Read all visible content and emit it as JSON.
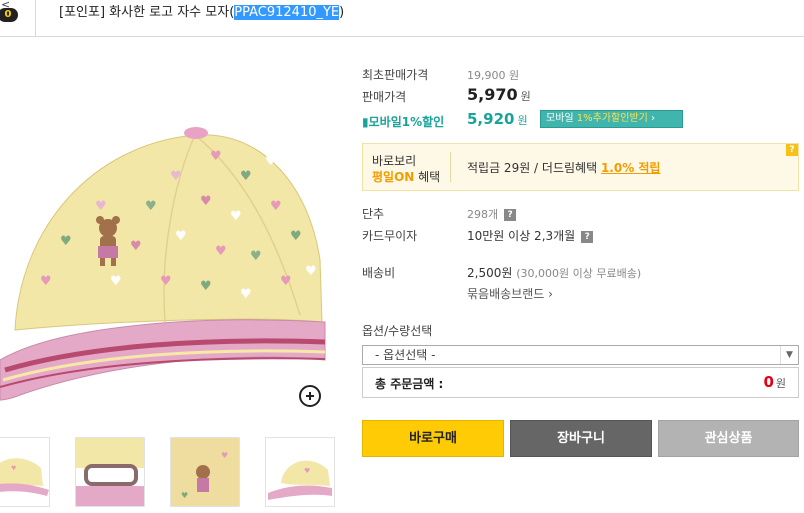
{
  "header": {
    "cart_count": "0",
    "title_prefix": "[포인포] 화사한 로고 자수 모자(",
    "title_code": "PPAC912410_YE",
    "title_suffix": ")"
  },
  "price": {
    "original_label": "최초판매가격",
    "original_value": "19,900 원",
    "sale_label": "판매가격",
    "sale_value": "5,970",
    "currency": "원",
    "mobile_label": "모바일1%할인",
    "mobile_value": "5,920",
    "mobile_button_a": "모바일 ",
    "mobile_button_b": "1%추가할인받기",
    "mobile_button_c": " ›"
  },
  "benefit": {
    "line1": "바로보리",
    "line2_on": "평일ON",
    "line2_rest": " 혜택",
    "points_text": "적립금 29원 / 더드림혜택 ",
    "points_pct": "1.0% 적립",
    "help": "?"
  },
  "details": {
    "stock_label": "단추",
    "stock_value": "298개",
    "card_label": "카드무이자",
    "card_value": "10만원 이상 2,3개월",
    "ship_label": "배송비",
    "ship_value": "2,500원",
    "ship_note": "(30,000원 이상 무료배송)",
    "bundle_link": "묶음배송브랜드 ›"
  },
  "options": {
    "label": "옵션/수량선택",
    "select_value": "- 옵션선택 -",
    "total_label": "총 주문금액 :",
    "total_value": "0",
    "total_unit": "원"
  },
  "buttons": {
    "buy": "바로구매",
    "cart": "장바구니",
    "wish": "관심상품"
  },
  "icons": [
    "chevron-left-icon",
    "zoom-plus-icon",
    "mobile-icon",
    "help-icon",
    "dropdown-arrow-icon"
  ]
}
